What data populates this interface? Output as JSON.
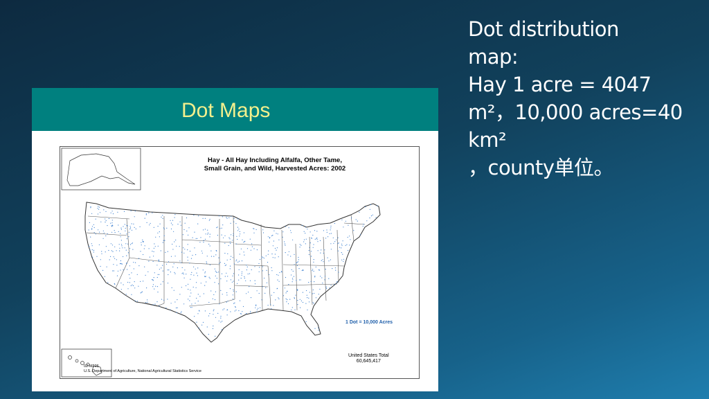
{
  "slide": {
    "text_lines": [
      "Dot distribution",
      "map:",
      "Hay  1 acre = 4047",
      "m²，10,000 acres=40",
      "km²",
      "，county单位。"
    ]
  },
  "card": {
    "header": "Dot Maps",
    "header_color": "#00807f",
    "header_text_color": "#f3f08d"
  },
  "map": {
    "title_line1": "Hay - All Hay Including Alfalfa, Other Tame,",
    "title_line2": "Small Grain, and Wild, Harvested Acres:  2002",
    "legend": "1 Dot = 10,000 Acres",
    "total_label": "United States Total",
    "total_value": "60,645,417",
    "map_id": "02-M226",
    "source": "U.S. Department of Agriculture, National Agricultural Statistics Service",
    "dot_color": "#3a7fd0"
  }
}
